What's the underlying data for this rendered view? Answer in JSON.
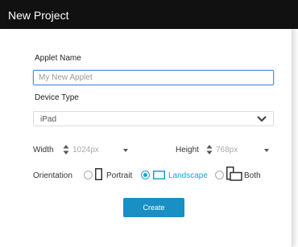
{
  "dialog": {
    "title": "New Project"
  },
  "applet_name": {
    "label": "Applet Name",
    "placeholder": "My New Applet",
    "value": ""
  },
  "device_type": {
    "label": "Device Type",
    "selected": "iPad"
  },
  "dimensions": {
    "width_label": "Width",
    "width_value": "1024px",
    "height_label": "Height",
    "height_value": "768px"
  },
  "orientation": {
    "label": "Orientation",
    "options": [
      {
        "label": "Portrait",
        "selected": false
      },
      {
        "label": "Landscape",
        "selected": true
      },
      {
        "label": "Both",
        "selected": false
      }
    ]
  },
  "actions": {
    "create_label": "Create"
  },
  "colors": {
    "accent": "#1fa0d6",
    "button": "#1a8fc4",
    "titlebar": "#111111"
  }
}
